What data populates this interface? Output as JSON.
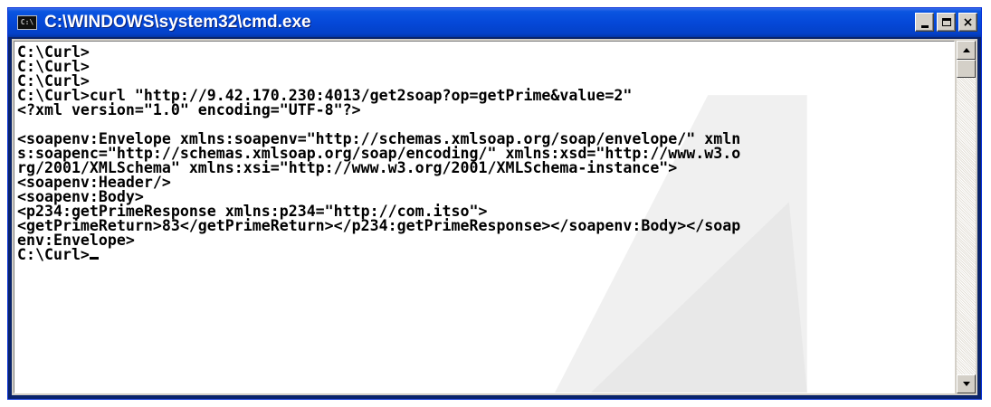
{
  "window": {
    "title": "C:\\WINDOWS\\system32\\cmd.exe",
    "icon": "console-icon",
    "icon_text": "C:\\",
    "buttons": {
      "minimize": "minimize-icon",
      "maximize": "maximize-icon",
      "close": "×"
    }
  },
  "console": {
    "lines": [
      "C:\\Curl>",
      "C:\\Curl>",
      "C:\\Curl>",
      "C:\\Curl>curl \"http://9.42.170.230:4013/get2soap?op=getPrime&value=2\"",
      "<?xml version=\"1.0\" encoding=\"UTF-8\"?>",
      "",
      "<soapenv:Envelope xmlns:soapenv=\"http://schemas.xmlsoap.org/soap/envelope/\" xmln",
      "s:soapenc=\"http://schemas.xmlsoap.org/soap/encoding/\" xmlns:xsd=\"http://www.w3.o",
      "rg/2001/XMLSchema\" xmlns:xsi=\"http://www.w3.org/2001/XMLSchema-instance\">",
      "<soapenv:Header/>",
      "<soapenv:Body>",
      "<p234:getPrimeResponse xmlns:p234=\"http://com.itso\">",
      "<getPrimeReturn>83</getPrimeReturn></p234:getPrimeResponse></soapenv:Body></soap",
      "env:Envelope>"
    ],
    "prompt": "C:\\Curl>"
  },
  "colors": {
    "titlebar": "#0548d8",
    "console_bg": "#ffffff",
    "console_fg": "#000000"
  }
}
